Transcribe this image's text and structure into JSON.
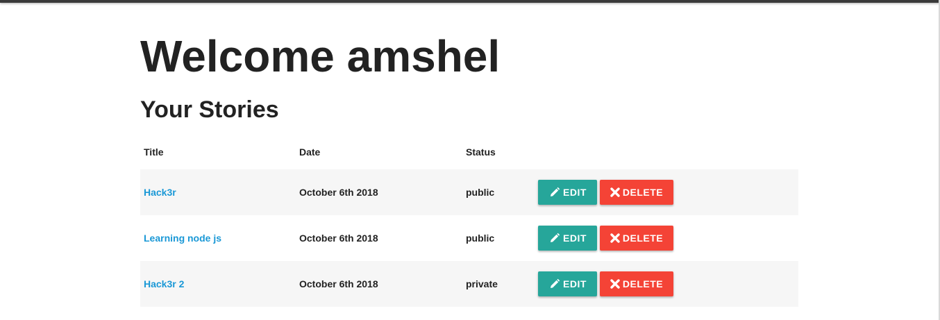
{
  "page": {
    "welcome": "Welcome amshel",
    "section_title": "Your Stories"
  },
  "table": {
    "headers": {
      "title": "Title",
      "date": "Date",
      "status": "Status"
    },
    "rows": [
      {
        "title": "Hack3r",
        "date": "October 6th 2018",
        "status": "public",
        "edit_label": "EDIT",
        "delete_label": "DELETE"
      },
      {
        "title": "Learning node js",
        "date": "October 6th 2018",
        "status": "public",
        "edit_label": "EDIT",
        "delete_label": "DELETE"
      },
      {
        "title": "Hack3r 2",
        "date": "October 6th 2018",
        "status": "private",
        "edit_label": "EDIT",
        "delete_label": "DELETE"
      }
    ]
  },
  "icons": {
    "edit": "pencil-icon",
    "delete": "times-icon"
  },
  "colors": {
    "link": "#1a98d6",
    "edit_button": "#26a69a",
    "delete_button": "#f44336",
    "row_stripe": "#f6f6f6",
    "text": "#222222"
  }
}
